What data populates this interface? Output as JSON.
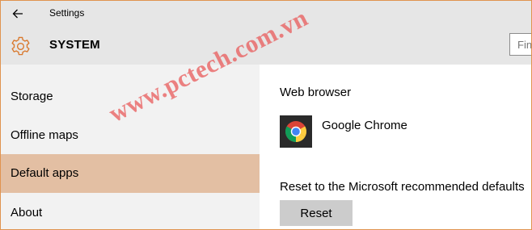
{
  "window": {
    "title": "Settings"
  },
  "header": {
    "title": "SYSTEM",
    "search_placeholder": "Find a setting"
  },
  "sidebar": {
    "items": [
      {
        "label": "Storage",
        "selected": false
      },
      {
        "label": "Offline maps",
        "selected": false
      },
      {
        "label": "Default apps",
        "selected": true
      },
      {
        "label": "About",
        "selected": false
      }
    ]
  },
  "content": {
    "web_browser": {
      "heading": "Web browser",
      "app_name": "Google Chrome",
      "icon": "chrome-icon"
    },
    "reset": {
      "label": "Reset to the Microsoft recommended defaults",
      "button": "Reset"
    }
  },
  "watermark": {
    "text": "www.pctech.com.vn"
  },
  "colors": {
    "accent": "#e3bfa3",
    "gear_accent": "#d9772b",
    "window_border": "#e0934f",
    "header_bg": "#e6e6e6",
    "sidebar_bg": "#f2f2f2",
    "button_bg": "#cccccc"
  }
}
